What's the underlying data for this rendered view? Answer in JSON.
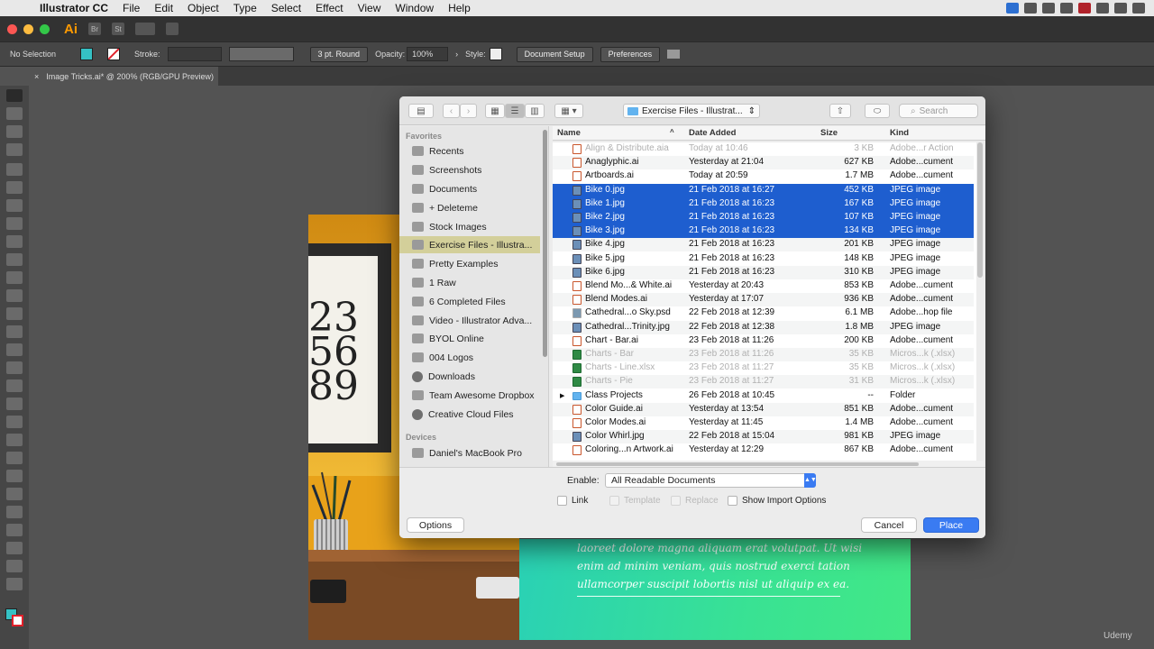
{
  "menubar": {
    "app": "Illustrator CC",
    "items": [
      "File",
      "Edit",
      "Object",
      "Type",
      "Select",
      "Effect",
      "View",
      "Window",
      "Help"
    ]
  },
  "appbar": {
    "logo": "Ai",
    "br": "Br",
    "st": "St"
  },
  "control_bar": {
    "selection": "No Selection",
    "stroke_label": "Stroke:",
    "brush": "3 pt. Round",
    "opacity_label": "Opacity:",
    "opacity_value": "100%",
    "style_label": "Style:",
    "document_setup": "Document Setup",
    "preferences": "Preferences",
    "fill_color": "#35c1c4"
  },
  "document_tab": {
    "close": "×",
    "title": "Image Tricks.ai* @ 200% (RGB/GPU Preview)"
  },
  "artboard": {
    "frame_digits": "23\n56\n89",
    "lorem": [
      "laoreet dolore magna aliquam erat volutpat. Ut wisi",
      "enim ad minim veniam, quis nostrud exerci tation",
      "ullamcorper suscipit lobortis nisl ut aliquip ex ea."
    ]
  },
  "dialog": {
    "location": "Exercise Files - Illustrat...",
    "search_placeholder": "Search",
    "sidebar": {
      "favorites_label": "Favorites",
      "favorites": [
        "Recents",
        "Screenshots",
        "Documents",
        "+ Deleteme",
        "Stock Images",
        "Exercise Files - Illustra...",
        "Pretty Examples",
        "1 Raw",
        "6 Completed Files",
        "Video - Illustrator Adva...",
        "BYOL Online",
        "004 Logos",
        "Downloads",
        "Team Awesome Dropbox",
        "Creative Cloud Files"
      ],
      "devices_label": "Devices",
      "devices": [
        "Daniel's MacBook Pro"
      ]
    },
    "columns": {
      "name": "Name",
      "date": "Date Added",
      "size": "Size",
      "kind": "Kind"
    },
    "files": [
      {
        "name": "Align & Distribute.aia",
        "date": "Today at 10:46",
        "size": "3 KB",
        "kind": "Adobe...r Action",
        "icon": "ai",
        "state": "dim"
      },
      {
        "name": "Anaglyphic.ai",
        "date": "Yesterday at 21:04",
        "size": "627 KB",
        "kind": "Adobe...cument",
        "icon": "ai",
        "state": ""
      },
      {
        "name": "Artboards.ai",
        "date": "Today at 20:59",
        "size": "1.7 MB",
        "kind": "Adobe...cument",
        "icon": "ai",
        "state": ""
      },
      {
        "name": "Bike 0.jpg",
        "date": "21 Feb 2018 at 16:27",
        "size": "452 KB",
        "kind": "JPEG image",
        "icon": "jpg",
        "state": "sel"
      },
      {
        "name": "Bike 1.jpg",
        "date": "21 Feb 2018 at 16:23",
        "size": "167 KB",
        "kind": "JPEG image",
        "icon": "jpg",
        "state": "sel"
      },
      {
        "name": "Bike 2.jpg",
        "date": "21 Feb 2018 at 16:23",
        "size": "107 KB",
        "kind": "JPEG image",
        "icon": "jpg",
        "state": "sel"
      },
      {
        "name": "Bike 3.jpg",
        "date": "21 Feb 2018 at 16:23",
        "size": "134 KB",
        "kind": "JPEG image",
        "icon": "jpg",
        "state": "sel"
      },
      {
        "name": "Bike 4.jpg",
        "date": "21 Feb 2018 at 16:23",
        "size": "201 KB",
        "kind": "JPEG image",
        "icon": "jpg",
        "state": ""
      },
      {
        "name": "Bike 5.jpg",
        "date": "21 Feb 2018 at 16:23",
        "size": "148 KB",
        "kind": "JPEG image",
        "icon": "jpg",
        "state": ""
      },
      {
        "name": "Bike 6.jpg",
        "date": "21 Feb 2018 at 16:23",
        "size": "310 KB",
        "kind": "JPEG image",
        "icon": "jpg",
        "state": ""
      },
      {
        "name": "Blend Mo...& White.ai",
        "date": "Yesterday at 20:43",
        "size": "853 KB",
        "kind": "Adobe...cument",
        "icon": "ai",
        "state": ""
      },
      {
        "name": "Blend Modes.ai",
        "date": "Yesterday at 17:07",
        "size": "936 KB",
        "kind": "Adobe...cument",
        "icon": "ai",
        "state": ""
      },
      {
        "name": "Cathedral...o Sky.psd",
        "date": "22 Feb 2018 at 12:39",
        "size": "6.1 MB",
        "kind": "Adobe...hop file",
        "icon": "psd",
        "state": ""
      },
      {
        "name": "Cathedral...Trinity.jpg",
        "date": "22 Feb 2018 at 12:38",
        "size": "1.8 MB",
        "kind": "JPEG image",
        "icon": "jpg",
        "state": ""
      },
      {
        "name": "Chart - Bar.ai",
        "date": "23 Feb 2018 at 11:26",
        "size": "200 KB",
        "kind": "Adobe...cument",
        "icon": "ai",
        "state": ""
      },
      {
        "name": "Charts - Bar",
        "date": "23 Feb 2018 at 11:26",
        "size": "35 KB",
        "kind": "Micros...k (.xlsx)",
        "icon": "xls",
        "state": "dim"
      },
      {
        "name": "Charts - Line.xlsx",
        "date": "23 Feb 2018 at 11:27",
        "size": "35 KB",
        "kind": "Micros...k (.xlsx)",
        "icon": "xls",
        "state": "dim"
      },
      {
        "name": "Charts - Pie",
        "date": "23 Feb 2018 at 11:27",
        "size": "31 KB",
        "kind": "Micros...k (.xlsx)",
        "icon": "xls",
        "state": "dim"
      },
      {
        "name": "Class Projects",
        "date": "26 Feb 2018 at 10:45",
        "size": "--",
        "kind": "Folder",
        "icon": "folder",
        "state": ""
      },
      {
        "name": "Color Guide.ai",
        "date": "Yesterday at 13:54",
        "size": "851 KB",
        "kind": "Adobe...cument",
        "icon": "ai",
        "state": ""
      },
      {
        "name": "Color Modes.ai",
        "date": "Yesterday at 11:45",
        "size": "1.4 MB",
        "kind": "Adobe...cument",
        "icon": "ai",
        "state": ""
      },
      {
        "name": "Color Whirl.jpg",
        "date": "22 Feb 2018 at 15:04",
        "size": "981 KB",
        "kind": "JPEG image",
        "icon": "jpg",
        "state": ""
      },
      {
        "name": "Coloring...n Artwork.ai",
        "date": "Yesterday at 12:29",
        "size": "867 KB",
        "kind": "Adobe...cument",
        "icon": "ai",
        "state": ""
      }
    ],
    "enable_label": "Enable:",
    "enable_value": "All Readable Documents",
    "checkboxes": {
      "link": "Link",
      "template": "Template",
      "replace": "Replace",
      "show_import": "Show Import Options"
    },
    "options_button": "Options",
    "cancel_button": "Cancel",
    "place_button": "Place"
  },
  "watermark": "Udemy"
}
